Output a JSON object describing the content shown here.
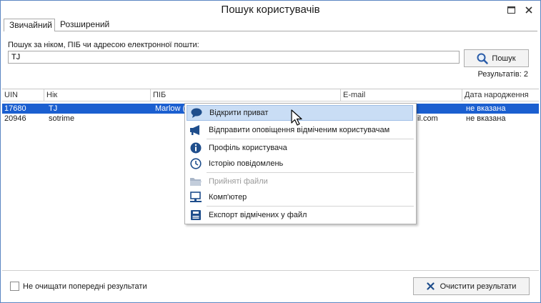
{
  "window": {
    "title": "Пошук користувачів"
  },
  "tabs": [
    {
      "label": "Звичайний",
      "active": true
    },
    {
      "label": "Розширений",
      "active": false
    }
  ],
  "search": {
    "label": "Пошук за ніком, ПІБ чи адресою електронної пошти:",
    "value": "TJ",
    "button_label": "Пошук"
  },
  "results": {
    "count_text": "Результатів: 2"
  },
  "table": {
    "columns": [
      "UIN",
      "Нік",
      "ПІБ",
      "E-mail",
      "Дата народження"
    ],
    "rows": [
      {
        "uin": "17680",
        "nick": "TJ",
        "name": "Marlow (",
        "email": "",
        "birthdate": "не вказана",
        "selected": true
      },
      {
        "uin": "20946",
        "nick": "sotrime",
        "name": "",
        "email": "il.com",
        "birthdate": "не вказана",
        "selected": false
      }
    ]
  },
  "context_menu": {
    "items": [
      {
        "label": "Відкрити приват",
        "icon": "chat-bubble-icon",
        "hover": true,
        "disabled": false
      },
      {
        "label": "Відправити оповіщення відміченим користувачам",
        "icon": "megaphone-icon",
        "disabled": false
      },
      {
        "label": "Профіль користувача",
        "icon": "info-icon",
        "disabled": false
      },
      {
        "label": "Історію повідомлень",
        "icon": "clock-icon",
        "disabled": false
      },
      {
        "label": "Прийняті файли",
        "icon": "folder-icon",
        "disabled": true
      },
      {
        "label": "Комп'ютер",
        "icon": "computer-icon",
        "disabled": false
      },
      {
        "label": "Експорт відмічених у файл",
        "icon": "export-icon",
        "disabled": false
      }
    ]
  },
  "footer": {
    "keep_results_label": "Не очищати попередні результати",
    "keep_results_checked": false,
    "clear_button_label": "Очистити результати"
  },
  "colors": {
    "selection": "#1b5fd0",
    "menu_hover": "#c9ddf5",
    "icon_blue": "#1f4e8c"
  }
}
